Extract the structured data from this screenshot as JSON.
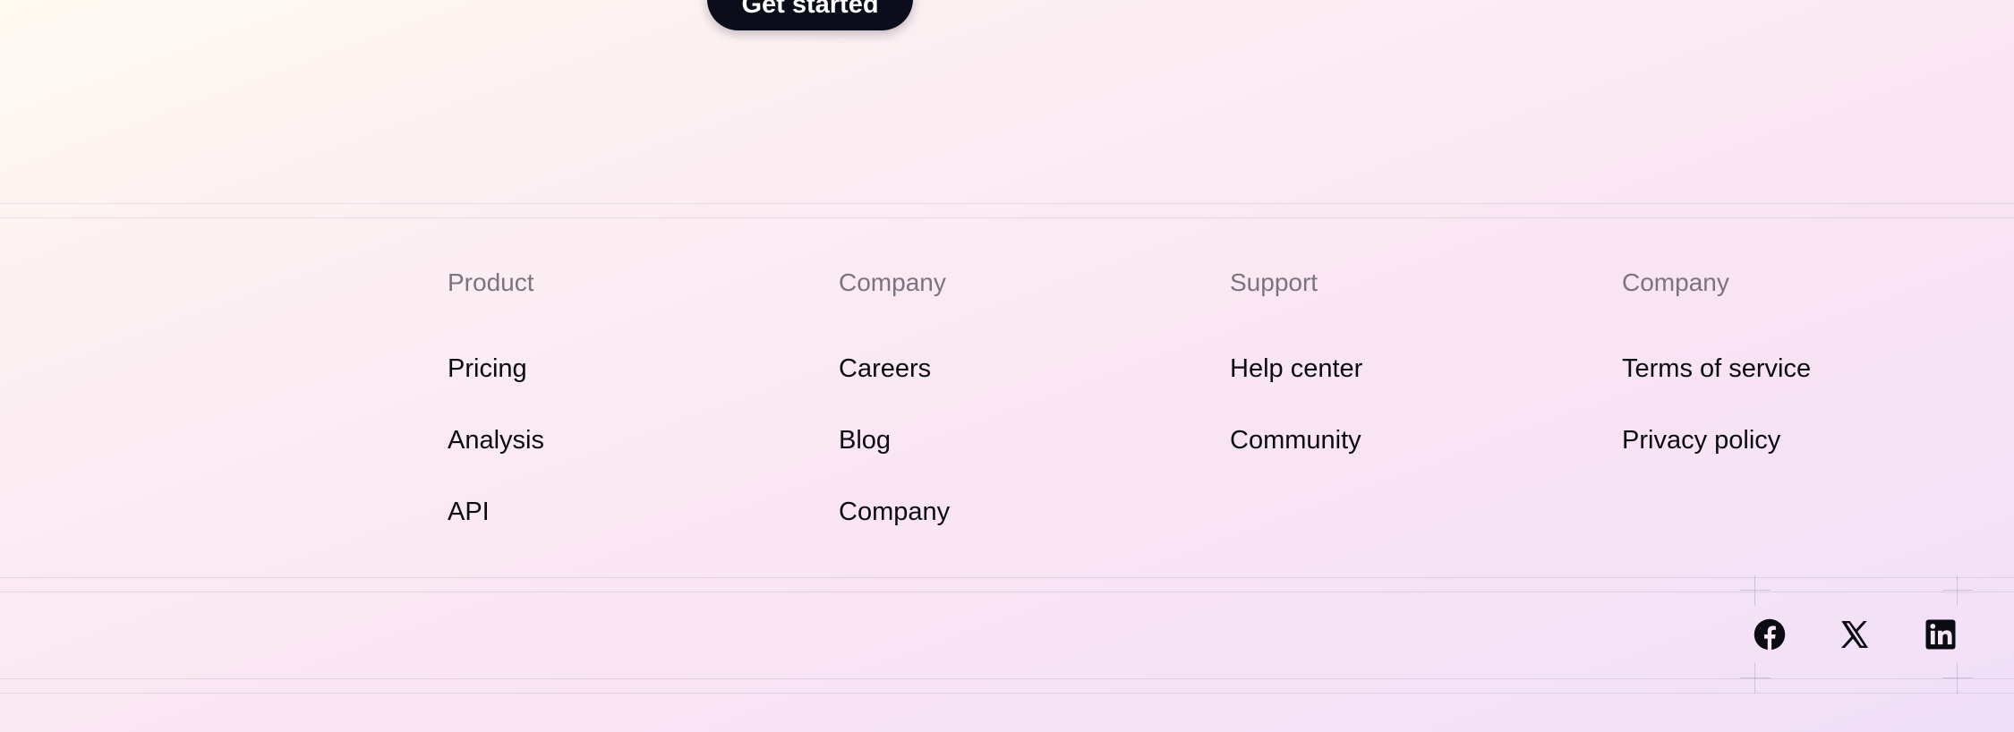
{
  "cta": {
    "label": "Get started"
  },
  "footer": {
    "columns": [
      {
        "heading": "Product",
        "links": [
          "Pricing",
          "Analysis",
          "API"
        ]
      },
      {
        "heading": "Company",
        "links": [
          "Careers",
          "Blog",
          "Company"
        ]
      },
      {
        "heading": "Support",
        "links": [
          "Help center",
          "Community"
        ]
      },
      {
        "heading": "Company",
        "links": [
          "Terms of service",
          "Privacy policy"
        ]
      }
    ],
    "social": [
      {
        "icon": "facebook-icon"
      },
      {
        "icon": "x-icon"
      },
      {
        "icon": "linkedin-icon"
      }
    ]
  },
  "colors": {
    "button_bg": "#0b0d1a",
    "heading_text": "#7b7480",
    "link_text": "#0b0b14"
  }
}
